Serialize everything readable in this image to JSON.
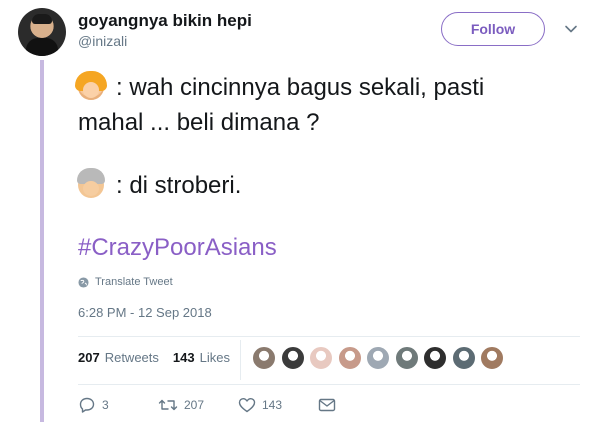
{
  "header": {
    "display_name": "goyangnya bikin hepi",
    "handle": "@inizali",
    "follow_label": "Follow"
  },
  "tweet": {
    "line1": ": wah cincinnya bagus sekali, pasti",
    "line2": "mahal ... beli dimana ?",
    "line3": ": di stroberi.",
    "hashtag": "#CrazyPoorAsians",
    "emoji_1": "woman-blonde-emoji",
    "emoji_2": "older-woman-emoji"
  },
  "translate_label": "Translate Tweet",
  "timestamp": "6:28 PM - 12 Sep 2018",
  "stats": {
    "retweets_count": "207",
    "retweets_label": "Retweets",
    "likes_count": "143",
    "likes_label": "Likes"
  },
  "liker_avatar_colors": [
    "#8a7a6e",
    "#3b3b3b",
    "#e8c9c0",
    "#c79a8a",
    "#9ea8b3",
    "#6f7a7a",
    "#2e2e2e",
    "#5c6b73",
    "#a07a60"
  ],
  "actions": {
    "replies": "3",
    "retweets": "207",
    "likes": "143"
  },
  "colors": {
    "accent": "#8a6ec6",
    "hashtag": "#8a5fc6",
    "thread_line": "#c7b9e0",
    "muted": "#657786"
  }
}
